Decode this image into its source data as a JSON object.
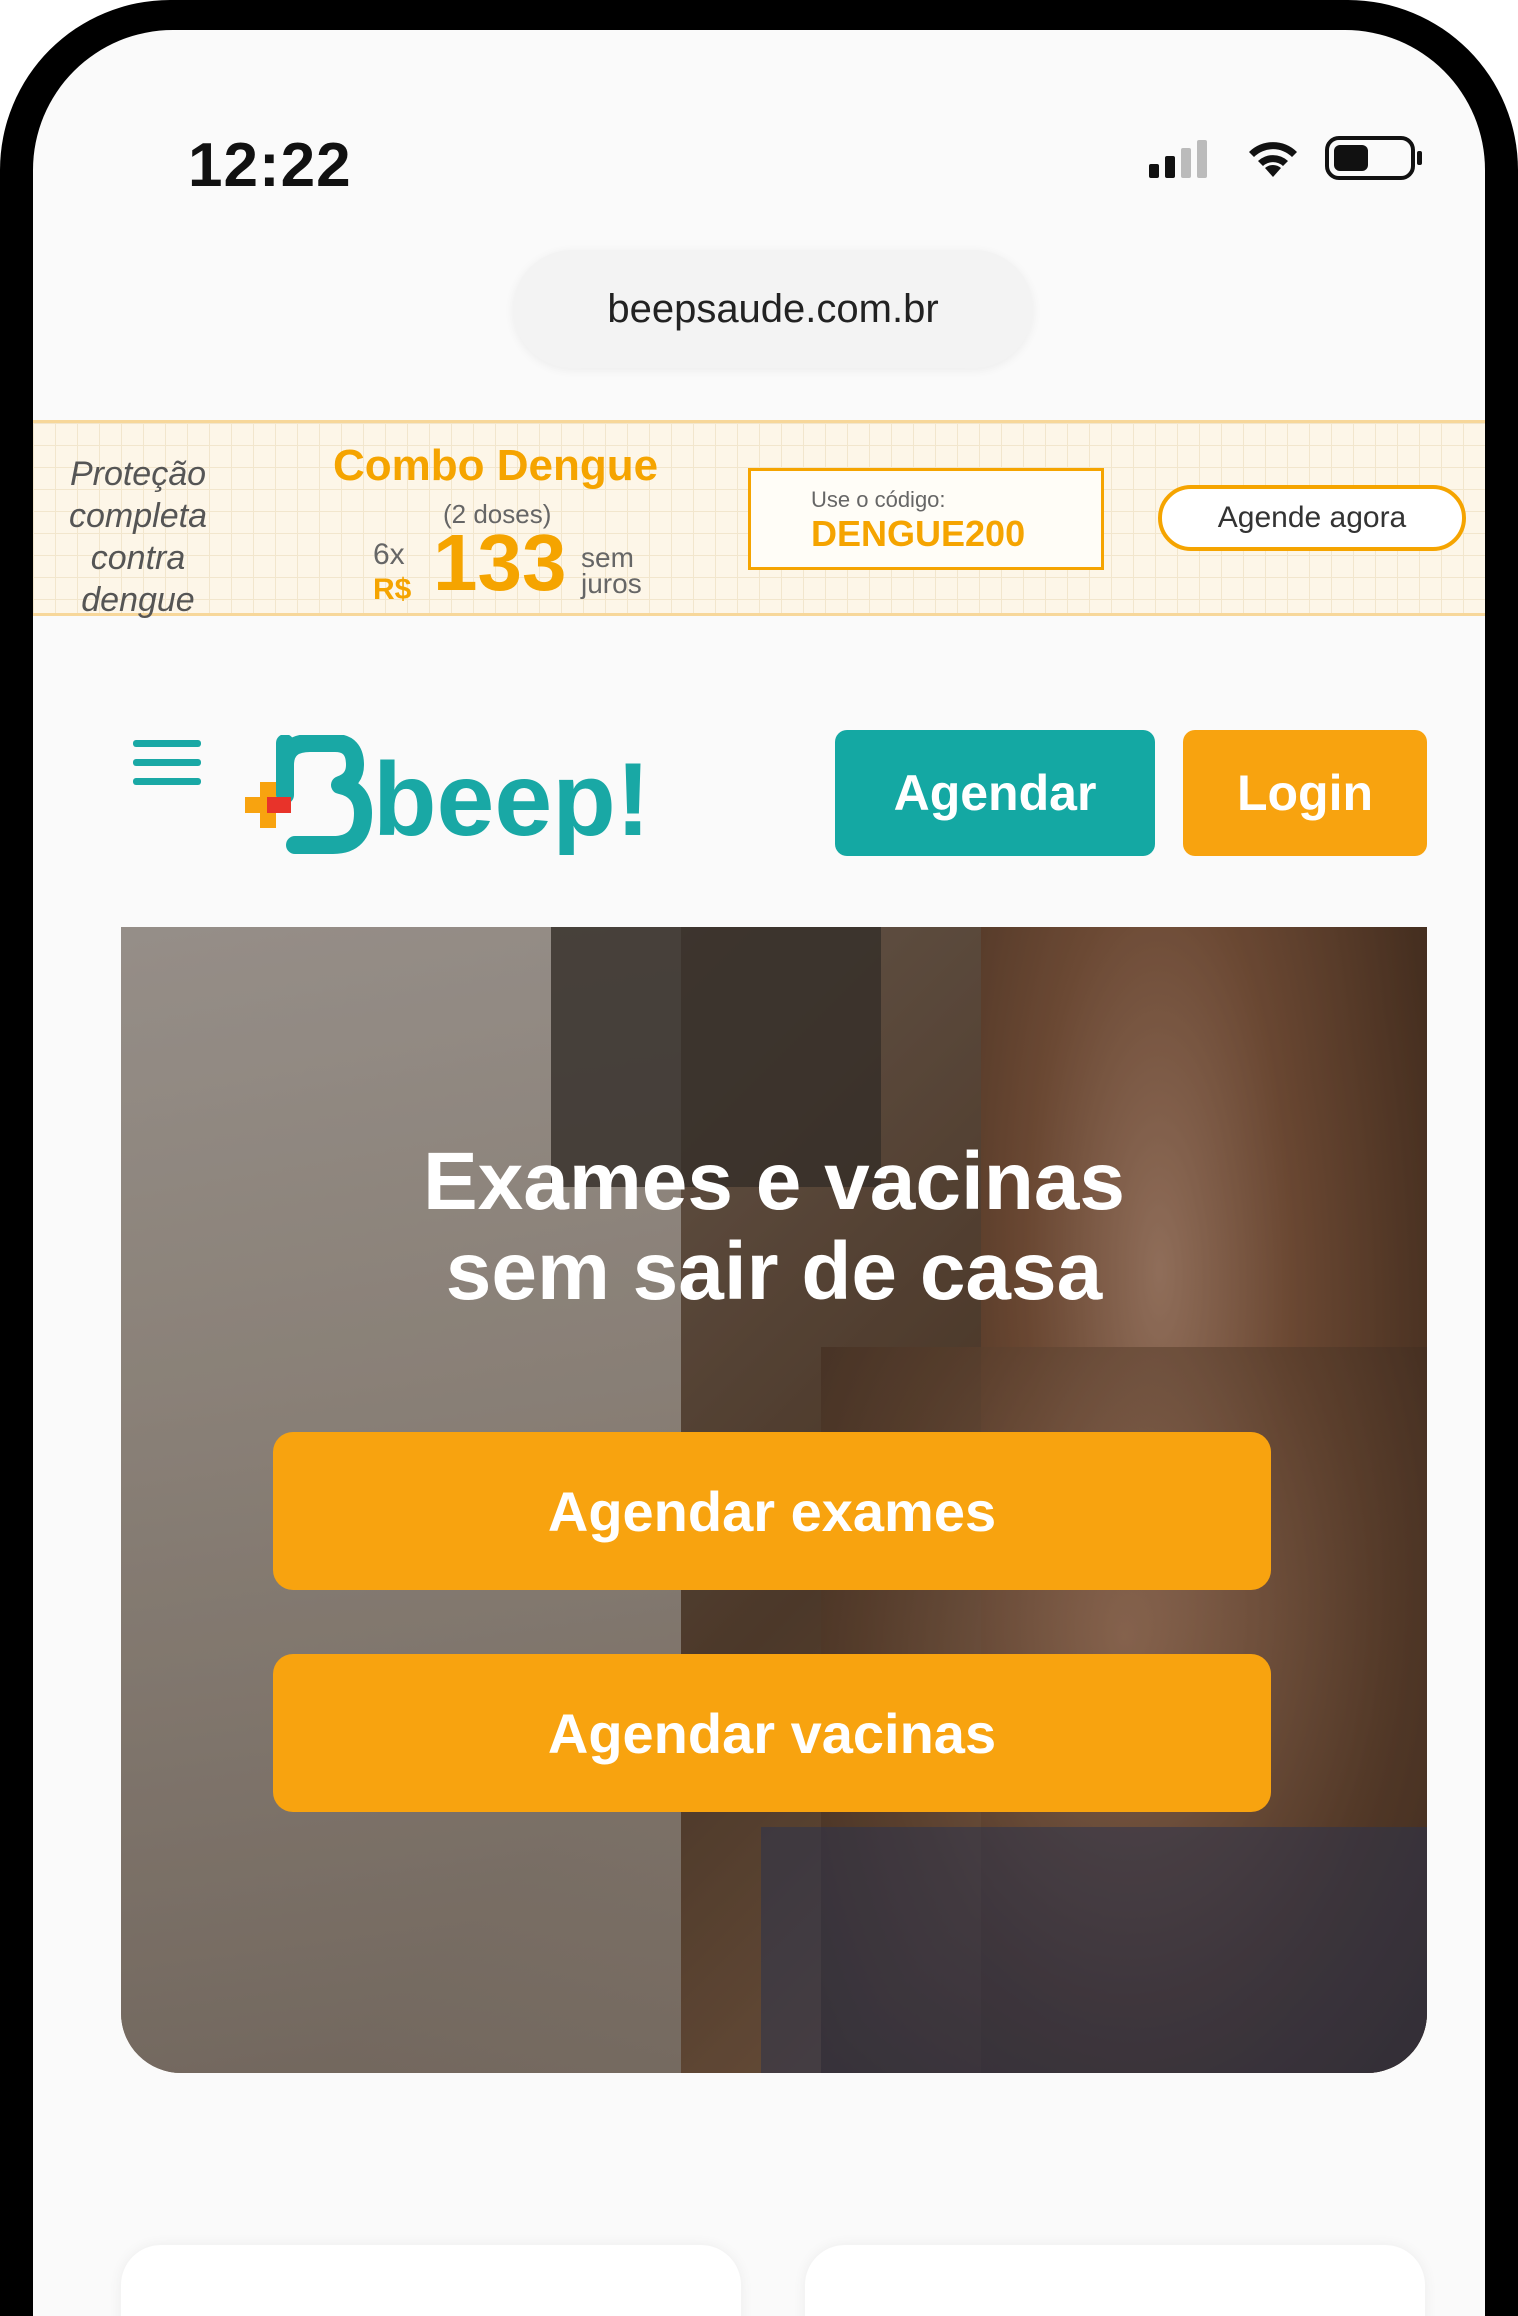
{
  "status_bar": {
    "time": "12:22",
    "icons": [
      "cellular-signal-icon",
      "wifi-icon",
      "battery-icon"
    ]
  },
  "browser": {
    "url": "beepsaude.com.br"
  },
  "promo_banner": {
    "tagline_line1": "Proteção",
    "tagline_line2": "completa",
    "tagline_line3": "contra dengue",
    "product": "Combo Dengue",
    "doses": "(2 doses)",
    "installments": "6x",
    "currency": "R$",
    "price": "133",
    "interest_line1": "sem",
    "interest_line2": "juros",
    "code_label": "Use o código:",
    "code": "DENGUE200",
    "cta": "Agende agora"
  },
  "navbar": {
    "logo_text": "beep!",
    "agendar_label": "Agendar",
    "login_label": "Login"
  },
  "hero": {
    "title_line1": "Exames e vacinas",
    "title_line2": "sem sair de casa",
    "btn_exames": "Agendar exames",
    "btn_vacinas": "Agendar vacinas"
  },
  "colors": {
    "teal": "#14a8a3",
    "orange": "#f8a30f",
    "promo_orange": "#f5a400",
    "logo_red": "#e8332a"
  }
}
